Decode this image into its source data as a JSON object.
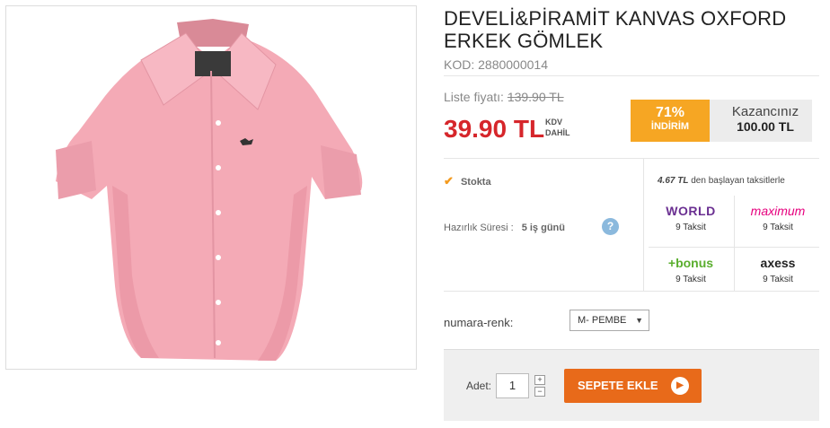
{
  "product": {
    "title_line1": "DEVELİ&PİRAMİT KANVAS OXFORD",
    "title_line2": "ERKEK GÖMLEK",
    "code": "KOD: 2880000014",
    "list_price_label": "Liste fiyatı:",
    "list_price": "139.90 TL",
    "price": "39.90 TL",
    "kdv_line1": "KDV",
    "kdv_line2": "DAHİL",
    "discount_pct": "71%",
    "discount_label": "İNDİRİM",
    "savings_label": "Kazancınız",
    "savings_value": "100.00 TL"
  },
  "stock": {
    "label": "Stokta",
    "prep_label": "Hazırlık Süresi :",
    "prep_value": "5 iş günü",
    "help_icon": "?"
  },
  "installments": {
    "head_value": "4.67 TL",
    "head_text": " den başlayan taksitlerle",
    "cards": [
      {
        "name": "WORLD",
        "color": "#6a2f91",
        "taksit": "9 Taksit"
      },
      {
        "name": "maximum",
        "color": "#e6007e",
        "taksit": "9 Taksit"
      },
      {
        "name": "+bonus",
        "color": "#5aae2e",
        "taksit": "9 Taksit"
      },
      {
        "name": "axess",
        "color": "#222222",
        "taksit": "9 Taksit"
      }
    ]
  },
  "variant": {
    "label": "numara-renk:",
    "selected": "M- PEMBE"
  },
  "cart": {
    "qty_label": "Adet:",
    "qty": "1",
    "plus": "+",
    "minus": "−",
    "button": "SEPETE EKLE"
  },
  "colors": {
    "accent": "#e86a1a",
    "price_red": "#d6262b",
    "discount": "#f6a623",
    "shirt": "#f4aab6"
  }
}
